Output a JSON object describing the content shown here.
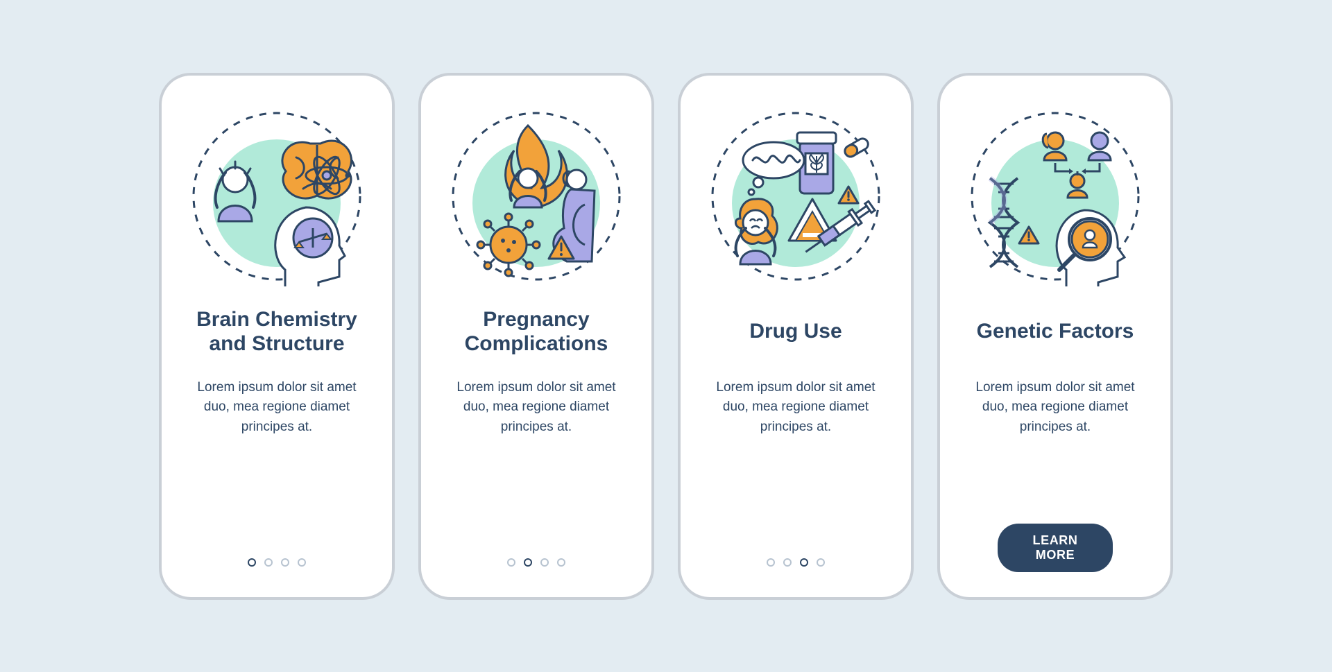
{
  "colors": {
    "navy": "#2d4664",
    "orange": "#f2a23a",
    "lavender": "#a9a8e6",
    "mint": "#b1ead9",
    "bg": "#e3ecf2"
  },
  "cards": [
    {
      "icon": "brain-chemistry-icon",
      "title": "Brain Chemistry\nand Structure",
      "desc": "Lorem ipsum dolor sit amet duo, mea regione diamet principes at.",
      "active_dot": 0,
      "cta": null
    },
    {
      "icon": "pregnancy-complications-icon",
      "title": "Pregnancy\nComplications",
      "desc": "Lorem ipsum dolor sit amet duo, mea regione diamet principes at.",
      "active_dot": 1,
      "cta": null
    },
    {
      "icon": "drug-use-icon",
      "title": "Drug Use",
      "desc": "Lorem ipsum dolor sit amet duo, mea regione diamet principes at.",
      "active_dot": 2,
      "cta": null
    },
    {
      "icon": "genetic-factors-icon",
      "title": "Genetic Factors",
      "desc": "Lorem ipsum dolor sit amet duo, mea regione diamet principes at.",
      "active_dot": 3,
      "cta": "LEARN MORE"
    }
  ],
  "dot_count": 4
}
